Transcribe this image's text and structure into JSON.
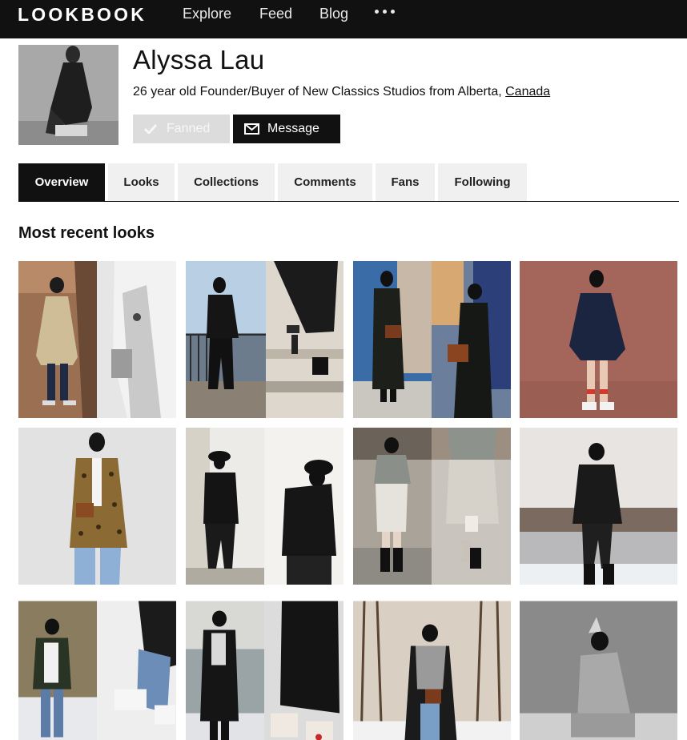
{
  "nav": {
    "logo": "LOOKBOOK",
    "links": [
      "Explore",
      "Feed",
      "Blog"
    ],
    "more_icon": "ellipsis-icon"
  },
  "profile": {
    "name": "Alyssa Lau",
    "bio_text": "26 year old Founder/Buyer of New Classics Studios from Alberta, ",
    "bio_link": "Canada",
    "fanned_label": "Fanned",
    "message_label": "Message"
  },
  "tabs": [
    {
      "label": "Overview",
      "active": true
    },
    {
      "label": "Looks",
      "active": false
    },
    {
      "label": "Collections",
      "active": false
    },
    {
      "label": "Comments",
      "active": false
    },
    {
      "label": "Fans",
      "active": false
    },
    {
      "label": "Following",
      "active": false
    }
  ],
  "section_title": "Most recent looks",
  "colors": {
    "nav_bg": "#111111",
    "tab_bg": "#f0f0f0",
    "fanned_bg": "#dcdcdc"
  }
}
